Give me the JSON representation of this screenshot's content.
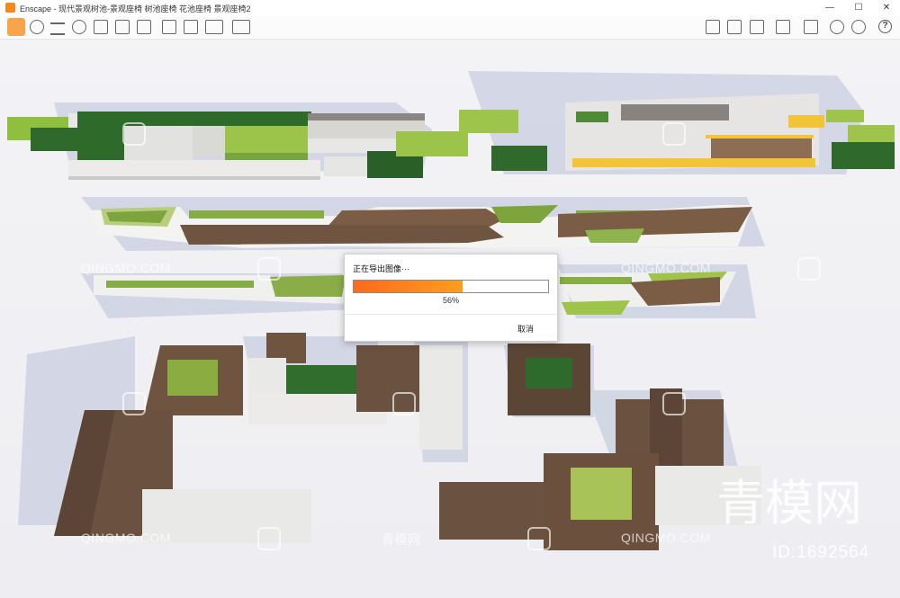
{
  "window": {
    "app_name": "Enscape",
    "title": "Enscape - 现代景观树池-景观座椅 树池座椅 花池座椅 景观座椅2",
    "minimize": "—",
    "maximize": "☐",
    "close": "✕"
  },
  "toolbar": {
    "collapse_icon": "chevron-up-icon",
    "help_label": "?"
  },
  "dialog": {
    "title": "正在导出图像···",
    "progress_percent": 56,
    "progress_label": "56%",
    "cancel_label": "取消"
  },
  "watermarks": {
    "site": "QINGMO.COM",
    "cn_small": "青模网",
    "cn_big": "青模网",
    "id_text": "ID:1692564"
  },
  "colors": {
    "accent": "#f28a1c",
    "progress_start": "#ff6a1a",
    "progress_end": "#ff9d1f"
  }
}
